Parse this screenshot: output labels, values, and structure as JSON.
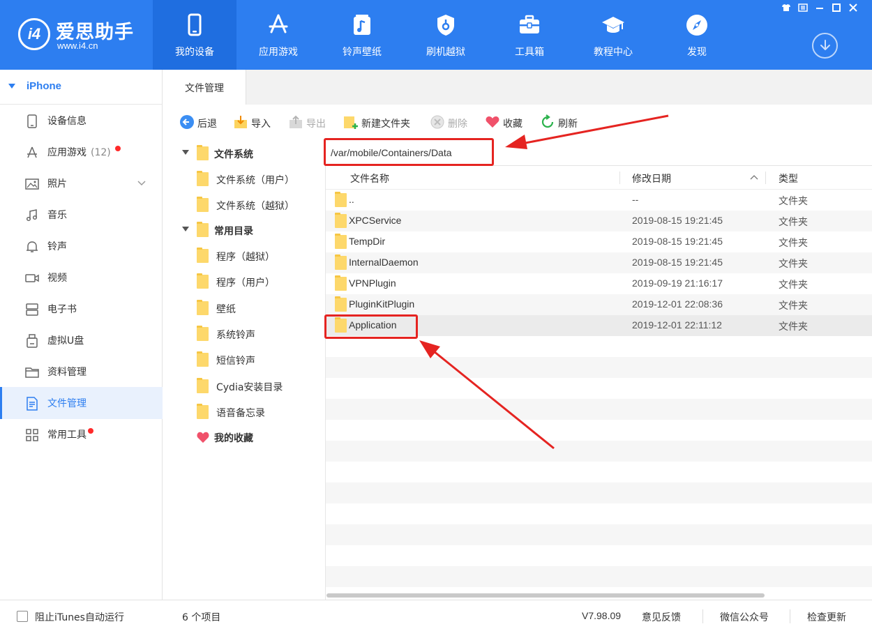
{
  "app": {
    "name": "爱思助手",
    "url": "www.i4.cn",
    "logo_text": "i4"
  },
  "nav": [
    {
      "label": "我的设备",
      "icon": "phone-icon",
      "active": true
    },
    {
      "label": "应用游戏",
      "icon": "app-store-icon",
      "active": false
    },
    {
      "label": "铃声壁纸",
      "icon": "music-note-icon",
      "active": false
    },
    {
      "label": "刷机越狱",
      "icon": "shield-icon",
      "active": false
    },
    {
      "label": "工具箱",
      "icon": "toolbox-icon",
      "active": false
    },
    {
      "label": "教程中心",
      "icon": "graduation-cap-icon",
      "active": false
    },
    {
      "label": "发现",
      "icon": "compass-icon",
      "active": false
    }
  ],
  "window_controls": [
    "skin-icon",
    "menu-icon",
    "minimize-icon",
    "maximize-icon",
    "close-icon"
  ],
  "sidebar": {
    "device": "iPhone",
    "items": [
      {
        "label": "设备信息",
        "icon": "device-info-icon"
      },
      {
        "label": "应用游戏",
        "count": "(12)",
        "icon": "apps-icon",
        "badge": true
      },
      {
        "label": "照片",
        "icon": "photo-icon",
        "expandable": true
      },
      {
        "label": "音乐",
        "icon": "music-icon"
      },
      {
        "label": "铃声",
        "icon": "bell-icon"
      },
      {
        "label": "视频",
        "icon": "video-icon"
      },
      {
        "label": "电子书",
        "icon": "ebook-icon"
      },
      {
        "label": "虚拟U盘",
        "icon": "usb-drive-icon"
      },
      {
        "label": "资料管理",
        "icon": "folder-outline-icon"
      },
      {
        "label": "文件管理",
        "icon": "document-icon",
        "active": true
      },
      {
        "label": "常用工具",
        "icon": "grid-icon",
        "badge": true
      }
    ]
  },
  "tabs": {
    "file_manager": "文件管理"
  },
  "toolbar": {
    "back": "后退",
    "import": "导入",
    "export": "导出",
    "new_folder": "新建文件夹",
    "delete": "删除",
    "favorite": "收藏",
    "refresh": "刷新"
  },
  "tree": {
    "filesystem": "文件系统",
    "filesystem_user": "文件系统（用户）",
    "filesystem_jailbreak": "文件系统（越狱）",
    "common_dirs": "常用目录",
    "apps_jailbreak": "程序（越狱）",
    "apps_user": "程序（用户）",
    "wallpaper": "壁纸",
    "system_ringtones": "系统铃声",
    "sms_ringtones": "短信铃声",
    "cydia_install": "Cydia安装目录",
    "voice_memos": "语音备忘录",
    "my_favorites": "我的收藏"
  },
  "path": "/var/mobile/Containers/Data",
  "columns": {
    "name": "文件名称",
    "date": "修改日期",
    "type": "类型"
  },
  "files": [
    {
      "name": "..",
      "date": "--",
      "type": "文件夹"
    },
    {
      "name": "XPCService",
      "date": "2019-08-15 19:21:45",
      "type": "文件夹"
    },
    {
      "name": "TempDir",
      "date": "2019-08-15 19:21:45",
      "type": "文件夹"
    },
    {
      "name": "InternalDaemon",
      "date": "2019-08-15 19:21:45",
      "type": "文件夹"
    },
    {
      "name": "VPNPlugin",
      "date": "2019-09-19 21:16:17",
      "type": "文件夹"
    },
    {
      "name": "PluginKitPlugin",
      "date": "2019-12-01 22:08:36",
      "type": "文件夹"
    },
    {
      "name": "Application",
      "date": "2019-12-01 22:11:12",
      "type": "文件夹"
    }
  ],
  "status": {
    "itunes_checkbox": "阻止iTunes自动运行",
    "item_count": "6 个项目",
    "version": "V7.98.09",
    "feedback": "意见反馈",
    "wechat": "微信公众号",
    "update": "检查更新"
  },
  "colors": {
    "brand": "#2d7ef0",
    "highlight": "#e52421",
    "folder": "#fdd86b"
  }
}
